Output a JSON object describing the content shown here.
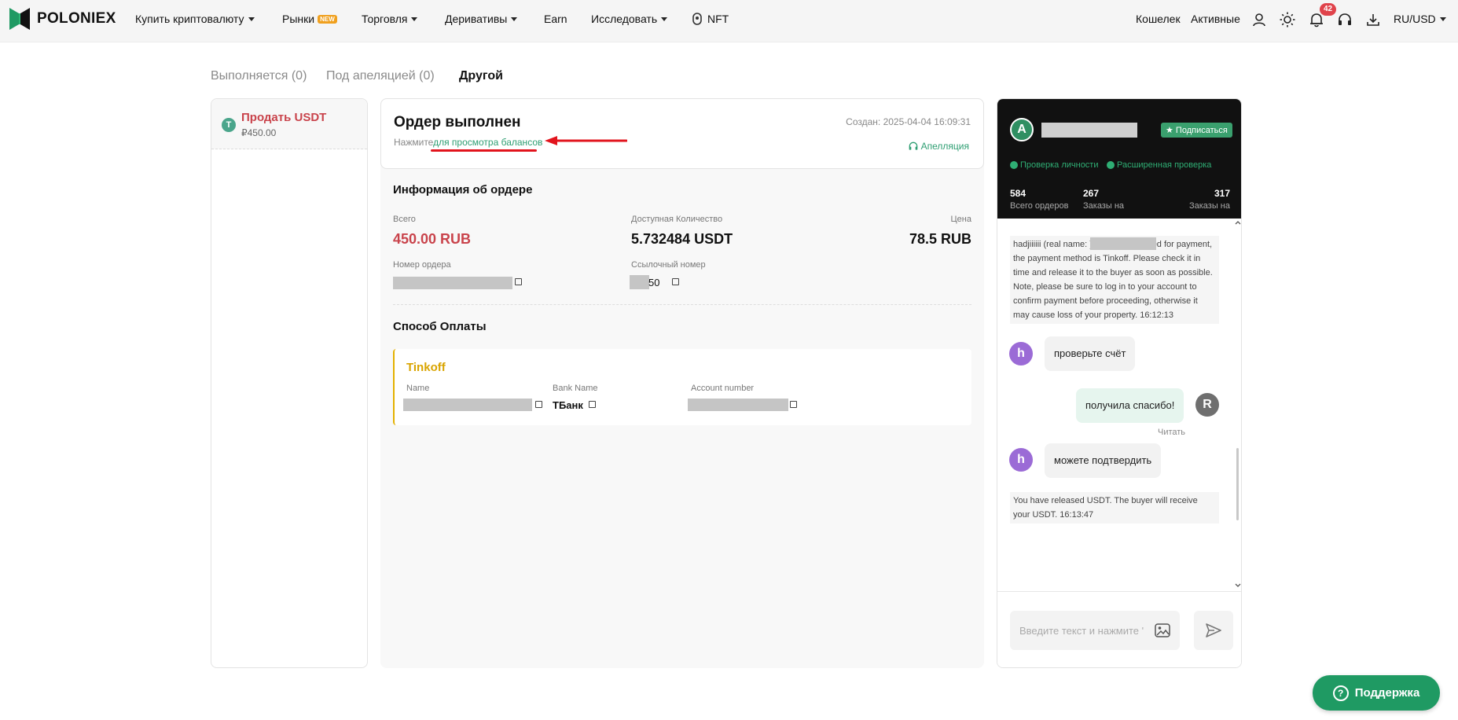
{
  "nav": {
    "logo_text": "POLONIEX",
    "items": [
      {
        "label": "Купить криптовалюту"
      },
      {
        "label": "Рынки",
        "badge": "NEW"
      },
      {
        "label": "Торговля"
      },
      {
        "label": "Деривативы"
      },
      {
        "label": "Earn"
      },
      {
        "label": "Исследовать"
      },
      {
        "label": "NFT"
      }
    ],
    "right": {
      "wallet": "Кошелек",
      "assets": "Активные",
      "notification_count": "42",
      "currency": "RU/USD"
    },
    "icons": [
      "user-icon",
      "sun-icon",
      "bell-icon",
      "headset-icon",
      "download-icon"
    ]
  },
  "tabs": [
    {
      "label": "Выполняется (0)",
      "active": false
    },
    {
      "label": "Под апеляцией (0)",
      "active": false
    },
    {
      "label": "Другой",
      "active": true
    }
  ],
  "left": {
    "coin_letter": "T",
    "title": "Продать USDT",
    "amount": "₽450.00"
  },
  "order": {
    "status_title": "Ордер выполнен",
    "hint_prefix": "Нажмите",
    "hint_link": "для просмотра балансов",
    "created": "Создан: 2025-04-04 16:09:31",
    "appeal": "Апелляция",
    "info_title": "Информация об ордере",
    "total_label": "Всего",
    "total_value": "450.00 RUB",
    "qty_label": "Доступная Количество",
    "qty_value": "5.732484 USDT",
    "price_label": "Цена",
    "price_value": "78.5 RUB",
    "order_no_label": "Номер ордера",
    "ref_label": "Ссылочный номер",
    "ref_visible_tail": "50"
  },
  "payment": {
    "title": "Способ Оплаты",
    "method": "Tinkoff",
    "name_label": "Name",
    "bank_label": "Bank Name",
    "bank_value": "ТБанк",
    "account_label": "Account number"
  },
  "chat": {
    "avatar_letter": "A",
    "subscribe": "Подписаться",
    "verify_1": "Проверка личности",
    "verify_2": "Расширенная проверка",
    "stats": [
      {
        "num": "584",
        "label": "Всего ордеров"
      },
      {
        "num": "267",
        "label": "Заказы на"
      },
      {
        "num": "317",
        "label": "Заказы на"
      }
    ],
    "sys_msg_1": "hadjiiiiii (real name:            ) has been marked for payment, the payment method is Tinkoff. Please check it in time and release it to the buyer as soon as possible. Note, please be sure to log in to your account to confirm payment before proceeding, otherwise it may cause loss of your property. 16:12:13",
    "msg_1": "проверьте счёт",
    "msg_2": "получила спасибо!",
    "read": "Читать",
    "msg_3": "можете подтвердить",
    "sys_msg_2": "You have released USDT. The buyer will receive your USDT. 16:13:47",
    "avatar_h": "h",
    "avatar_r": "R",
    "input_placeholder": "Введите текст и нажмите '"
  },
  "support": {
    "label": "Поддержка"
  },
  "colors": {
    "accent_green": "#2e9e72",
    "sell_red": "#c9434b",
    "annotation_red": "#e2141d",
    "tinkoff_yellow": "#d9a400"
  }
}
